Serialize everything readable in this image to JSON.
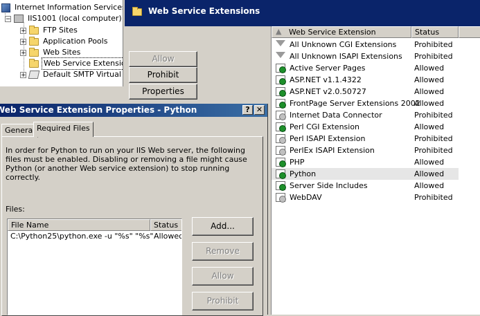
{
  "tree": {
    "root_label": "Internet Information Services",
    "server_label": "IIS1001 (local computer)",
    "items": [
      {
        "label": "FTP Sites",
        "expander": "+"
      },
      {
        "label": "Application Pools",
        "expander": "+"
      },
      {
        "label": "Web Sites",
        "expander": "+"
      },
      {
        "label": "Web Service Extensions",
        "expander": ""
      },
      {
        "label": "Default SMTP Virtual Server",
        "expander": "+"
      }
    ]
  },
  "banner": {
    "title": "Web Service Extensions"
  },
  "actions": {
    "allow": "Allow",
    "prohibit": "Prohibit",
    "properties": "Properties"
  },
  "ext_list": {
    "columns": [
      "Web Service Extension",
      "Status"
    ],
    "rows": [
      {
        "name": "All Unknown CGI Extensions",
        "status": "Prohibited"
      },
      {
        "name": "All Unknown ISAPI Extensions",
        "status": "Prohibited"
      },
      {
        "name": "Active Server Pages",
        "status": "Allowed"
      },
      {
        "name": "ASP.NET v1.1.4322",
        "status": "Allowed"
      },
      {
        "name": "ASP.NET v2.0.50727",
        "status": "Allowed"
      },
      {
        "name": "FrontPage Server Extensions 2002",
        "status": "Allowed"
      },
      {
        "name": "Internet Data Connector",
        "status": "Prohibited"
      },
      {
        "name": "Perl CGI Extension",
        "status": "Allowed"
      },
      {
        "name": "Perl ISAPI Extension",
        "status": "Prohibited"
      },
      {
        "name": "PerlEx ISAPI Extension",
        "status": "Prohibited"
      },
      {
        "name": "PHP",
        "status": "Allowed"
      },
      {
        "name": "Python",
        "status": "Allowed"
      },
      {
        "name": "Server Side Includes",
        "status": "Allowed"
      },
      {
        "name": "WebDAV",
        "status": "Prohibited"
      }
    ]
  },
  "dialog": {
    "title": "Web Service Extension Properties - Python",
    "help_glyph": "?",
    "close_glyph": "✕",
    "tabs": [
      "General",
      "Required Files"
    ],
    "description": "In order for Python to run on your IIS Web server, the following files must be enabled.  Disabling or removing a file might cause Python (or another Web service extension) to stop running correctly.",
    "files_label": "Files:",
    "files_columns": [
      "File Name",
      "Status"
    ],
    "files": [
      {
        "name": "C:\\Python25\\python.exe -u \"%s\" \"%s\"",
        "status": "Allowed"
      }
    ],
    "buttons": {
      "add": "Add...",
      "remove": "Remove",
      "allow": "Allow",
      "prohibit": "Prohibit"
    }
  }
}
